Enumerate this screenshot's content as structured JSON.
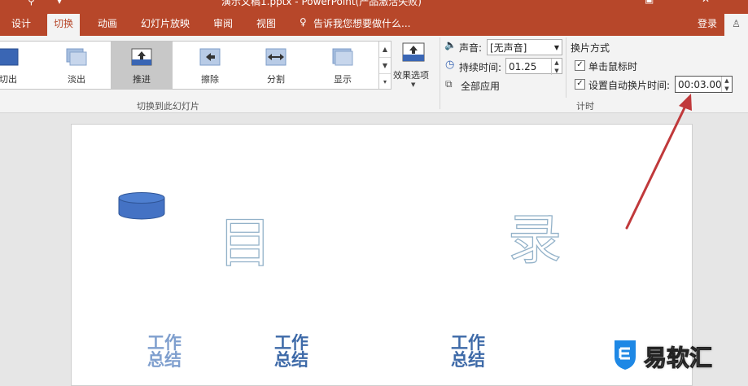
{
  "window": {
    "title": "演示文稿1.pptx - PowerPoint(产品激活失败)"
  },
  "tabs": [
    {
      "label": "设计"
    },
    {
      "label": "切换"
    },
    {
      "label": "动画"
    },
    {
      "label": "幻灯片放映"
    },
    {
      "label": "审阅"
    },
    {
      "label": "视图"
    }
  ],
  "active_tab": "切换",
  "tell_me": "告诉我您想要做什么...",
  "account": {
    "login": "登录"
  },
  "transitions": {
    "items": [
      {
        "label": "切出",
        "icon": "cut-transition-icon"
      },
      {
        "label": "淡出",
        "icon": "fade-transition-icon"
      },
      {
        "label": "推进",
        "icon": "push-transition-icon",
        "selected": true
      },
      {
        "label": "擦除",
        "icon": "wipe-transition-icon"
      },
      {
        "label": "分割",
        "icon": "split-transition-icon"
      },
      {
        "label": "显示",
        "icon": "reveal-transition-icon"
      }
    ],
    "effect_options": "效果选项",
    "group_label": "切换到此幻灯片"
  },
  "timing": {
    "sound_label": "声音:",
    "sound_value": "[无声音]",
    "duration_label": "持续时间:",
    "duration_value": "01.25",
    "apply_all": "全部应用",
    "advance_title": "换片方式",
    "on_click_label": "单击鼠标时",
    "on_click_checked": true,
    "auto_label": "设置自动换片时间:",
    "auto_checked": true,
    "auto_value": "00:03.00",
    "group_label": "计时"
  },
  "slide": {
    "title_left": "目",
    "title_right": "录",
    "items": [
      "工作总结",
      "工作总结",
      "工作总结"
    ],
    "shape_color": "#4472c4"
  },
  "watermark": {
    "text": "易软汇"
  },
  "colors": {
    "accent": "#b7472a",
    "ribbon_bg": "#f3f3f3",
    "arrow": "#c0393b"
  }
}
